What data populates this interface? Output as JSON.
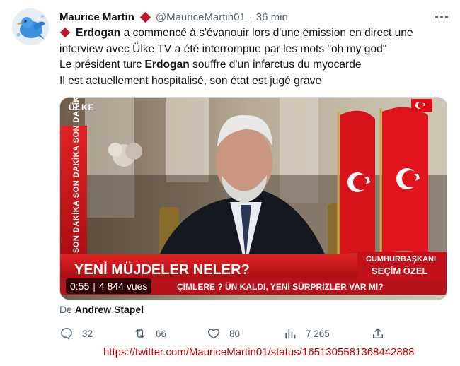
{
  "author": {
    "name": "Maurice Martin",
    "handle": "@MauriceMartin01",
    "separator": "·",
    "time": "36 min"
  },
  "tweet": {
    "line1_bold": "Erdogan",
    "line1_rest": " a commencé à s'évanouir lors d'une émission en direct,une",
    "line2": "interview avec Ülke TV a été interrompue par les mots \"oh my god\"",
    "line3_pre": "Le président turc ",
    "line3_bold": "Erdogan",
    "line3_post": " souffre d'un infarctus du myocarde",
    "line4": "Il est actuellement hospitalisé, son état est jugé grave"
  },
  "media": {
    "channel_logo": "ÜLKE",
    "side_banner": "SON DAKİKA",
    "headline": "YENİ MÜJDELER NELER?",
    "ticker": "SEÇİMLERE 2 GÜN KALDI, YENİ SÜRPRİZLER VAR MI?",
    "ticker_visible": "ÇİMLERE ? ÜN KALDI, YENİ SÜRPRİZLER VAR MI?",
    "caption_line1": "CUMHURBAŞKANI",
    "caption_line2": "SEÇİM ÖZEL",
    "duration": "0:55",
    "duration_sep": "|",
    "views": "4 844 vues"
  },
  "attribution": {
    "prefix": "De",
    "name": "Andrew Stapel"
  },
  "actions": {
    "replies": "32",
    "retweets": "66",
    "likes": "80",
    "views": "7 265"
  },
  "source_url": "https://twitter.com/MauriceMartin01/status/1651305581368442888",
  "colors": {
    "accent_red": "#c0162c",
    "text_primary": "#0f1419",
    "text_secondary": "#536471",
    "url_red": "#cc0000"
  },
  "icons": [
    "more-icon",
    "reply-icon",
    "retweet-icon",
    "like-icon",
    "views-icon",
    "share-icon",
    "diamond-icon"
  ]
}
